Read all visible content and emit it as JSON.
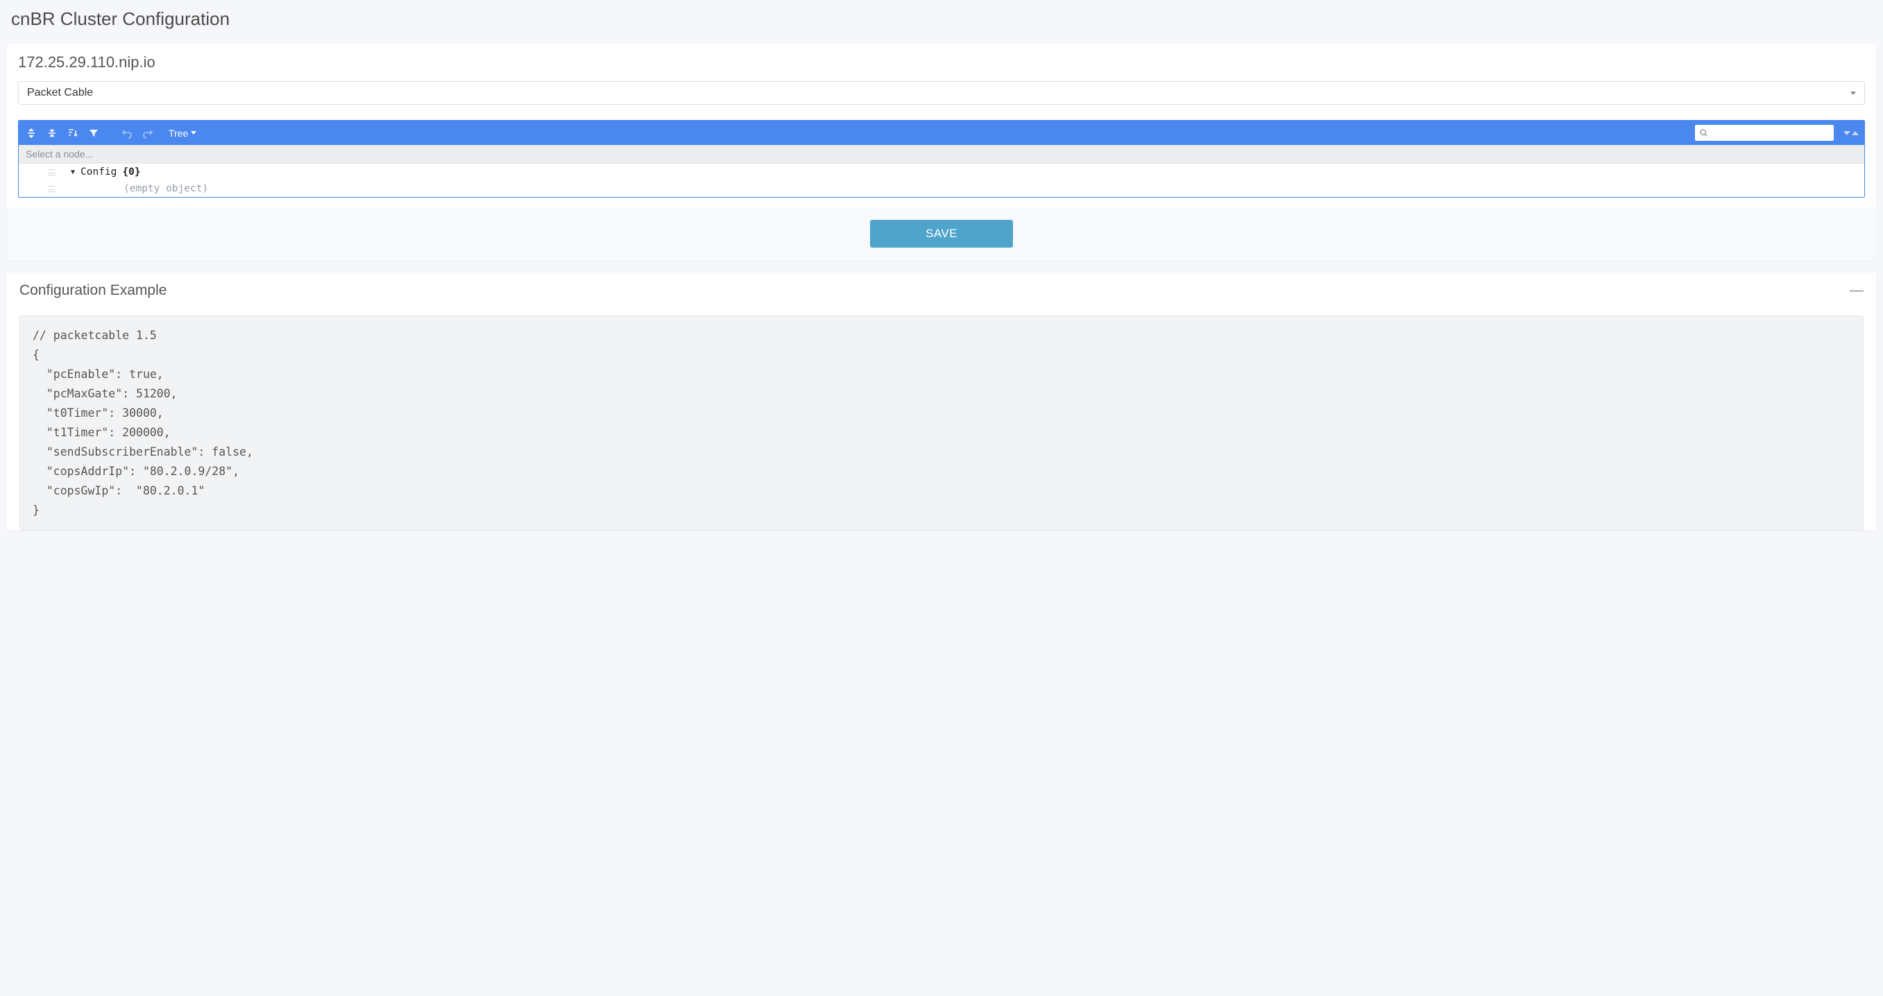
{
  "page": {
    "title": "cnBR Cluster Configuration"
  },
  "host": "172.25.29.110.nip.io",
  "selector": {
    "selected": "Packet Cable"
  },
  "editor": {
    "mode": "Tree",
    "hint": "Select a node...",
    "root_key": "Config",
    "root_count": "{0}",
    "empty_text": "(empty object)"
  },
  "buttons": {
    "save": "SAVE"
  },
  "example": {
    "title": "Configuration Example",
    "code": "// packetcable 1.5\n{\n  \"pcEnable\": true,\n  \"pcMaxGate\": 51200,\n  \"t0Timer\": 30000,\n  \"t1Timer\": 200000,\n  \"sendSubscriberEnable\": false,\n  \"copsAddrIp\": \"80.2.0.9/28\",\n  \"copsGwIp\":  \"80.2.0.1\"\n}"
  }
}
